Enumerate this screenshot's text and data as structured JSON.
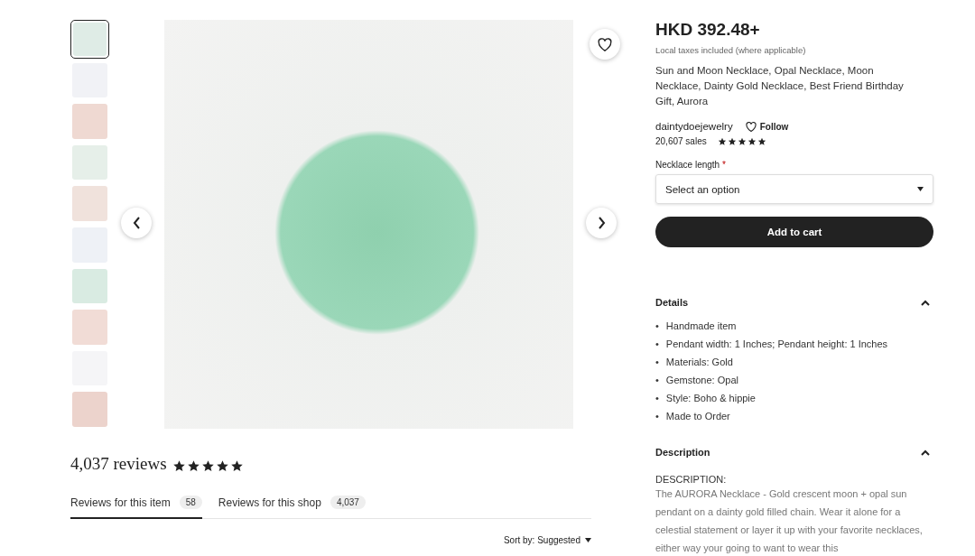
{
  "gallery": {
    "thumbnails": [
      {
        "selected": true
      },
      {
        "selected": false
      },
      {
        "selected": false
      },
      {
        "selected": false
      },
      {
        "selected": false
      },
      {
        "selected": false
      },
      {
        "selected": false
      },
      {
        "selected": false
      },
      {
        "selected": false
      },
      {
        "selected": false
      }
    ]
  },
  "reviews": {
    "heading": "4,037 reviews",
    "stars": 5,
    "tabs": [
      {
        "label": "Reviews for this item",
        "count": "58",
        "selected": true
      },
      {
        "label": "Reviews for this shop",
        "count": "4,037",
        "selected": false
      }
    ],
    "sort": "Sort by: Suggested"
  },
  "listing": {
    "price": "HKD 392.48+",
    "tax_note": "Local taxes included (where applicable)",
    "title": "Sun and Moon Necklace, Opal Necklace, Moon Necklace, Dainty Gold Necklace, Best Friend Birthday Gift, Aurora",
    "shop": "daintydoejewelry",
    "follow": "Follow",
    "sales": "20,607 sales",
    "stars": 5,
    "option_label": "Necklace length",
    "required_mark": "*",
    "select_placeholder": "Select an option",
    "add_to_cart": "Add to cart"
  },
  "details": {
    "title": "Details",
    "expanded": true,
    "bullet": "•",
    "items": [
      "Handmade item",
      "Pendant width: 1 Inches; Pendant height: 1 Inches",
      "Materials: Gold",
      "Gemstone: Opal",
      "Style: Boho & hippie",
      "Made to Order"
    ]
  },
  "description": {
    "title": "Description",
    "expanded": true,
    "heading": "DESCRIPTION:",
    "text": "The AURORA Necklace - Gold crescent moon + opal sun pendant on a dainty gold filled chain. Wear it alone for a celestial statement or layer it up with your favorite necklaces, either way your going to want to wear this"
  }
}
